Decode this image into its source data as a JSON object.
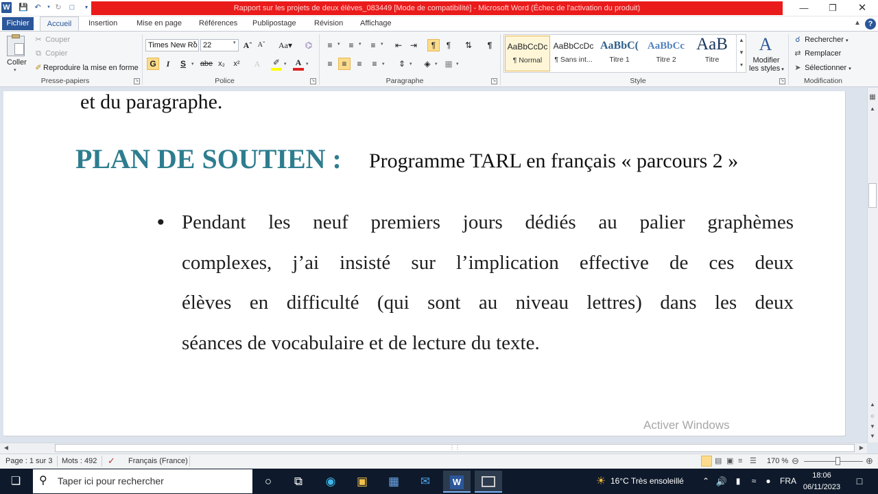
{
  "title_bar": {
    "title": "Rapport sur les projets de deux élèves_083449 [Mode de compatibilité] - Microsoft Word (Échec de l'activation du produit)"
  },
  "tabs": [
    {
      "label": "Fichier"
    },
    {
      "label": "Accueil"
    },
    {
      "label": "Insertion"
    },
    {
      "label": "Mise en page"
    },
    {
      "label": "Références"
    },
    {
      "label": "Publipostage"
    },
    {
      "label": "Révision"
    },
    {
      "label": "Affichage"
    }
  ],
  "clipboard": {
    "group_label": "Presse-papiers",
    "paste": "Coller",
    "cut": "Couper",
    "copy": "Copier",
    "format_painter": "Reproduire la mise en forme"
  },
  "font": {
    "group_label": "Police",
    "font_name": "Times New Ro",
    "font_size": "22",
    "bold": "G",
    "italic": "I",
    "underline": "S",
    "strike": "abe",
    "subscript": "x₂",
    "superscript": "x²"
  },
  "paragraph": {
    "group_label": "Paragraphe"
  },
  "styles": {
    "group_label": "Style",
    "items": [
      {
        "preview": "AaBbCcDc",
        "name": "¶ Normal"
      },
      {
        "preview": "AaBbCcDc",
        "name": "¶ Sans int..."
      },
      {
        "preview": "AaBbC(",
        "name": "Titre 1"
      },
      {
        "preview": "AaBbCc",
        "name": "Titre 2"
      },
      {
        "preview": "AaB",
        "name": "Titre"
      }
    ],
    "change_styles_line1": "Modifier",
    "change_styles_line2": "les styles"
  },
  "editing": {
    "group_label": "Modification",
    "find": "Rechercher",
    "replace": "Remplacer",
    "select": "Sélectionner"
  },
  "document": {
    "line_prev": "et du paragraphe.",
    "heading": "PLAN DE SOUTIEN :",
    "subheading": "Programme TARL en français « parcours 2 »",
    "bullet": "•",
    "para_lines": [
      "Pendant les neuf premiers jours dédiés au palier graphèmes",
      "complexes, j’ai insisté sur l’implication effective de ces deux",
      "élèves en difficulté (qui sont au niveau lettres) dans les deux",
      "séances de vocabulaire et de lecture du texte."
    ],
    "watermark": "Activer Windows"
  },
  "status_bar": {
    "page": "Page : 1 sur 3",
    "words": "Mots : 492",
    "language": "Français (France)",
    "zoom": "170 %"
  },
  "taskbar": {
    "search_placeholder": "Taper ici pour rechercher",
    "weather": "16°C  Très ensoleillé",
    "lang": "FRA",
    "time": "18:06",
    "date": "06/11/2023"
  }
}
